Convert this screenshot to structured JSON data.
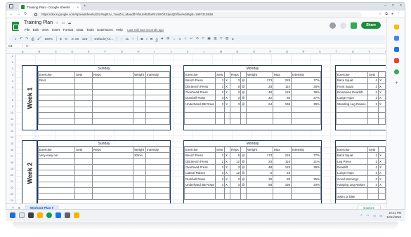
{
  "browser": {
    "tab_title": "Training Plan - Google Sheets",
    "tab_close": "×",
    "new_tab": "+",
    "url": "https://docs.google.com/spreadsheets/d/1VNgRzv_7uwZm_MaadfhYhiUHEdhxRnzWOEXlpuQDfhw/edit#gid=1997215938",
    "nav": {
      "back": "←",
      "forward": "→",
      "reload": "⟳"
    },
    "window_controls": {
      "minimize": "–",
      "maximize": "□",
      "close": "×"
    }
  },
  "doc": {
    "title": "Training Plan",
    "menus": [
      "File",
      "Edit",
      "View",
      "Insert",
      "Format",
      "Data",
      "Tools",
      "Extensions",
      "Help"
    ],
    "last_edit": "Last edit was seconds ago",
    "share_label": "Share",
    "avatar_letter": "J"
  },
  "toolbar": {
    "zoom": "100%",
    "currency": "$",
    "percent": "%",
    "decimals": ".0  .00",
    "number_format": "123",
    "font": "Default (Ari...",
    "font_size": "11"
  },
  "formula_bar": {
    "cell_ref": "C4",
    "fx": "fx"
  },
  "columns": [
    "A",
    "B",
    "C",
    "D",
    "E",
    "F",
    "G",
    "H",
    "I",
    "J",
    "K",
    "L",
    "M",
    "N",
    "O",
    "P",
    "Q",
    "R",
    "S",
    "T",
    "U",
    "V",
    "W"
  ],
  "rows": [
    "1",
    "2",
    "3",
    "4",
    "5",
    "6",
    "7",
    "8",
    "9",
    "10",
    "11",
    "12",
    "13",
    "14",
    "15",
    "16",
    "17",
    "18",
    "19",
    "20",
    "21",
    "22",
    "23",
    "24"
  ],
  "weeks": [
    "Week 1",
    "Week 2"
  ],
  "week1": {
    "sunday": {
      "day": "Sunday",
      "headers": [
        "Exercise",
        "Sets",
        "Reps",
        "Weight",
        "Intensity"
      ],
      "rows": [
        [
          "Rest",
          "",
          "",
          "",
          ""
        ]
      ]
    },
    "monday": {
      "day": "Monday",
      "headers": [
        "Exercise",
        "Sets",
        "",
        "Reps",
        "",
        "Weight",
        "Max",
        "Intensity"
      ],
      "rows": [
        [
          "Bench Press",
          "3",
          "X",
          "3",
          "@",
          "173",
          "225",
          "77%"
        ],
        [
          "DB Bench Press",
          "3",
          "X",
          "8",
          "@",
          "28",
          "110",
          "25%"
        ],
        [
          "Overhead Press",
          "3",
          "X",
          "3",
          "@",
          "48",
          "125",
          "39%"
        ],
        [
          "Dumbell Rows",
          "3",
          "X",
          "3",
          "@",
          "22",
          "80",
          "27%"
        ],
        [
          "Underhand BB Rows",
          "3",
          "X",
          "3",
          "@",
          "64",
          "195",
          "39%"
        ]
      ]
    },
    "tuesday": {
      "headers": [
        "Exercise",
        "Sets"
      ],
      "rows": [
        [
          "Back Squat",
          "4",
          "X"
        ],
        [
          "Front Squat",
          "3",
          "X"
        ],
        [
          "Romanian Deadlift",
          "3",
          "X"
        ],
        [
          "Lunge Hops",
          "3",
          "X"
        ],
        [
          "Standing Leg Raises",
          "3",
          "X"
        ]
      ]
    }
  },
  "week2": {
    "sunday": {
      "day": "Sunday",
      "headers": [
        "Exercise",
        "Sets",
        "Reps",
        "Weight",
        "Intensity"
      ],
      "rows": [
        [
          "Very easy run",
          "",
          "",
          "30min",
          ""
        ]
      ]
    },
    "monday": {
      "day": "Monday",
      "headers": [
        "Exercise",
        "Sets",
        "",
        "Reps",
        "",
        "Weight",
        "Max",
        "Intensity"
      ],
      "rows": [
        [
          "Bench Press",
          "3",
          "X",
          "5",
          "@",
          "173",
          "225",
          "77%"
        ],
        [
          "DB Bench Press",
          "2",
          "X",
          "12",
          "@",
          "23",
          "110",
          "21%"
        ],
        [
          "Overhead Press",
          "3",
          "X",
          "3",
          "@",
          "48",
          "125",
          "38%"
        ],
        [
          "Lateral Raises",
          "3",
          "X",
          "12",
          "@",
          "5",
          "25",
          ""
        ],
        [
          "Dumbell Rows",
          "3",
          "X",
          "3",
          "@",
          "20",
          "80",
          "25%"
        ],
        [
          "Underhand BB Rows",
          "3",
          "X",
          "3",
          "@",
          "58",
          "195",
          "34%"
        ]
      ]
    },
    "tuesday": {
      "headers": [
        "Exercise",
        "Sets"
      ],
      "rows": [
        [
          "Back Squat",
          "2",
          "X"
        ],
        [
          "Leg Press",
          "3",
          "X"
        ],
        [
          "Deadlift",
          "2",
          "X"
        ],
        [
          "Lunge Hops",
          "3",
          "X"
        ],
        [
          "Good Mornings",
          "3",
          "X"
        ],
        [
          "Hanging Leg Raises",
          "3",
          "X"
        ]
      ],
      "extra": "Swim or bike"
    }
  },
  "sheet_tabs": {
    "add": "+",
    "list": "≡",
    "active": "Workout Plan ▾"
  },
  "explore_label": "Explore",
  "taskbar": {
    "time": "10:41 PM",
    "date": "12/11/2022"
  },
  "colors": {
    "green": "#1e8e3e",
    "navy": "#1f3a68",
    "blue": "#0b57d0"
  }
}
